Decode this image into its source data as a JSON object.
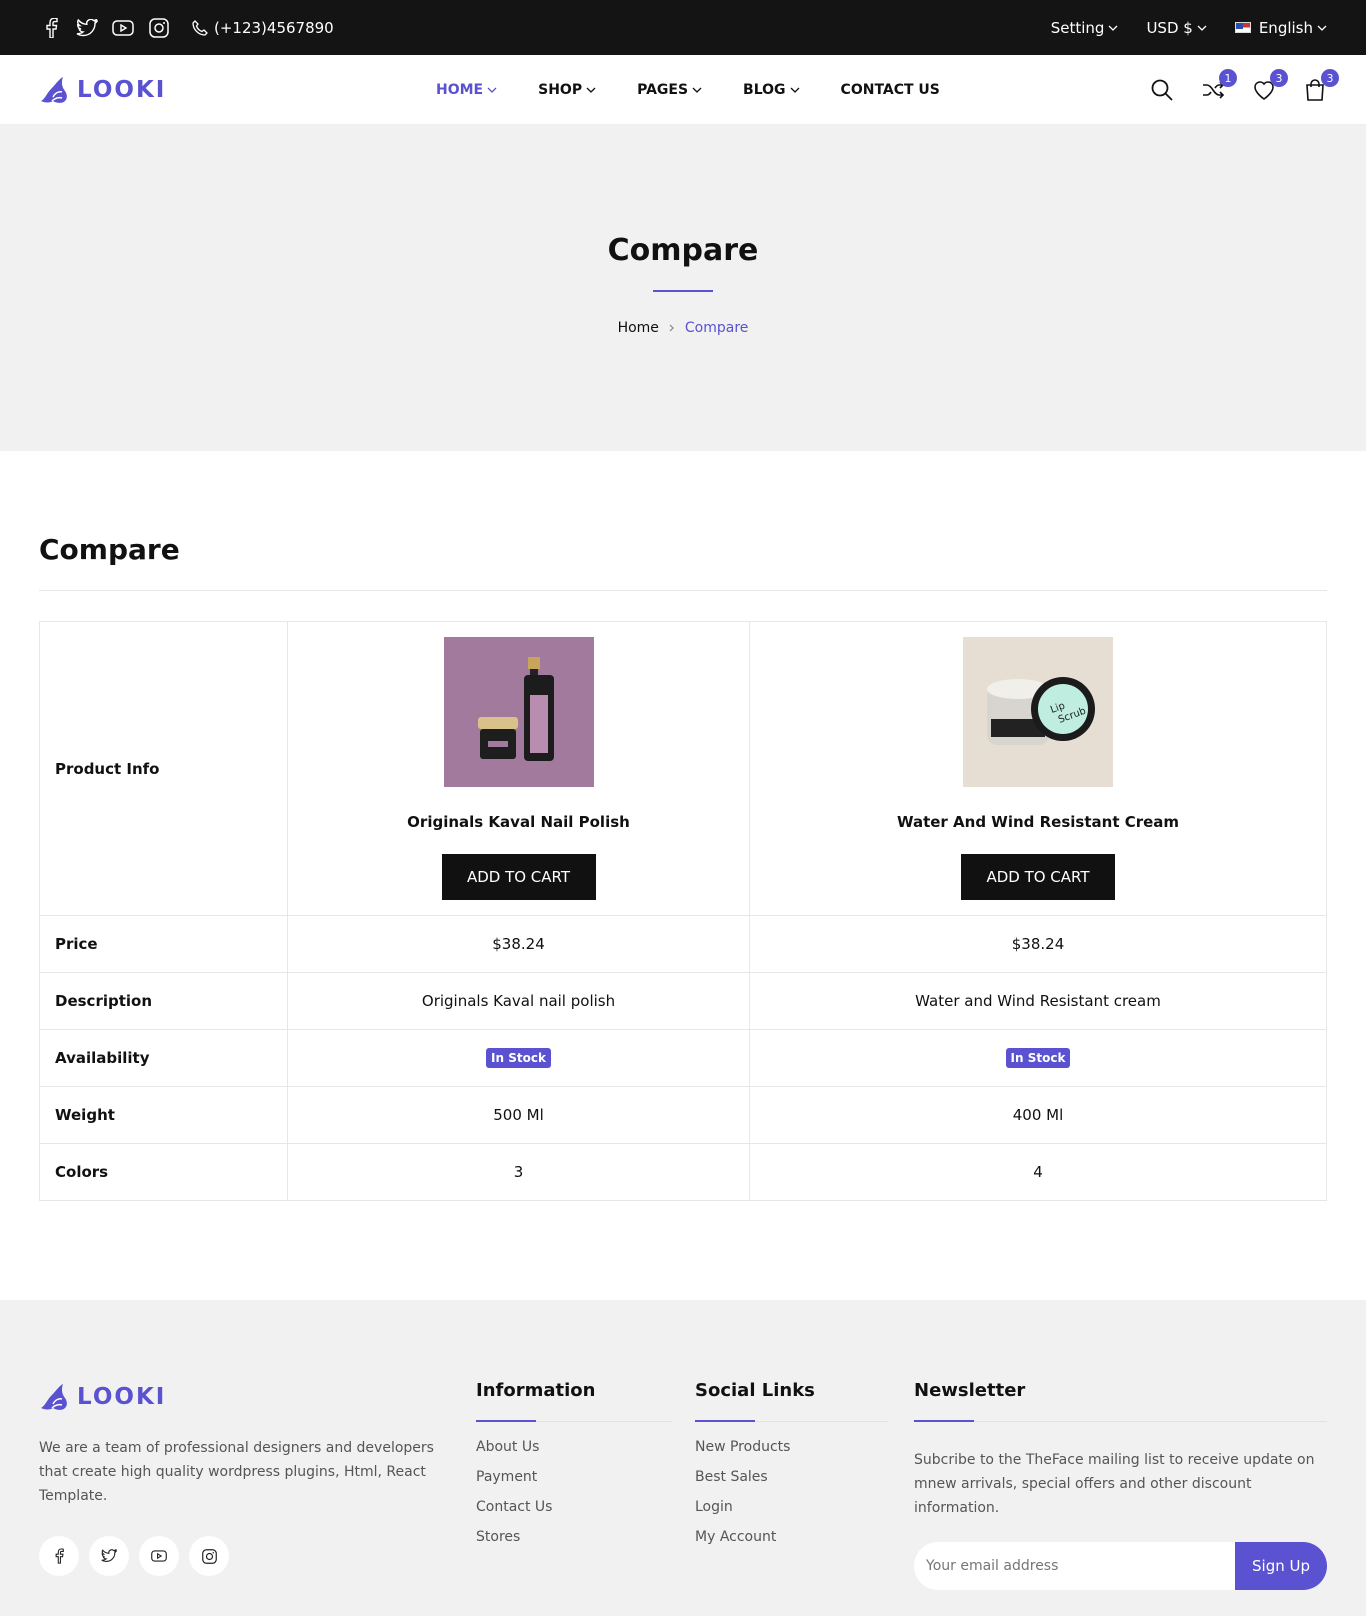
{
  "topbar": {
    "phone": "(+123)4567890",
    "setting": "Setting",
    "currency": "USD $",
    "language": "English"
  },
  "header": {
    "logo": "LOOKI",
    "nav": [
      {
        "label": "HOME",
        "dropdown": true,
        "active": true
      },
      {
        "label": "SHOP",
        "dropdown": true
      },
      {
        "label": "PAGES",
        "dropdown": true
      },
      {
        "label": "BLOG",
        "dropdown": true
      },
      {
        "label": "CONTACT US",
        "dropdown": false
      }
    ],
    "badges": {
      "compare": "1",
      "wishlist": "3",
      "cart": "3"
    },
    "accent": "#5a52d0"
  },
  "hero": {
    "title": "Compare",
    "breadcrumb": {
      "home": "Home",
      "current": "Compare"
    }
  },
  "compare": {
    "title": "Compare",
    "rows": {
      "product_info": "Product Info",
      "price": "Price",
      "description": "Description",
      "availability": "Availability",
      "weight": "Weight",
      "colors": "Colors"
    },
    "products": [
      {
        "name": "Originals Kaval Nail Polish",
        "button": "ADD TO CART",
        "price": "$38.24",
        "description": "Originals Kaval nail polish",
        "availability": "In Stock",
        "weight": "500 Ml",
        "colors": "3",
        "image_bg": "#a27a9e"
      },
      {
        "name": "Water And Wind Resistant Cream",
        "button": "ADD TO CART",
        "price": "$38.24",
        "description": "Water and Wind Resistant cream",
        "availability": "In Stock",
        "weight": "400 Ml",
        "colors": "4",
        "image_bg": "#e6ddd3"
      }
    ]
  },
  "footer": {
    "logo": "LOOKI",
    "about": "We are a team of professional designers and developers that create high quality wordpress plugins, Html, React Template.",
    "information": {
      "title": "Information",
      "links": [
        "About Us",
        "Payment",
        "Contact Us",
        "Stores"
      ]
    },
    "social": {
      "title": "Social Links",
      "links": [
        "New Products",
        "Best Sales",
        "Login",
        "My Account"
      ]
    },
    "newsletter": {
      "title": "Newsletter",
      "text": "Subcribe to the TheFace mailing list to receive update on mnew arrivals, special offers and other discount information.",
      "placeholder": "Your email address",
      "button": "Sign Up"
    }
  }
}
